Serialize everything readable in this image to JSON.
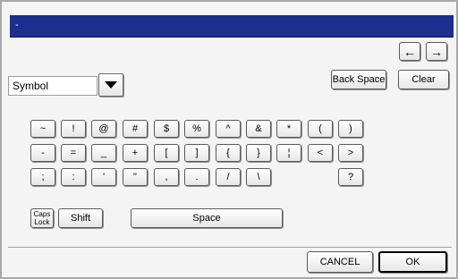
{
  "title": "-",
  "nav": {
    "left_arrow": "←",
    "right_arrow": "→"
  },
  "category": {
    "selected": "Symbol"
  },
  "buttons": {
    "backspace": "Back Space",
    "clear": "Clear",
    "caps_line1": "Caps",
    "caps_line2": "Lock",
    "shift": "Shift",
    "space": "Space",
    "cancel": "CANCEL",
    "ok": "OK"
  },
  "keys": {
    "row1": [
      "~",
      "!",
      "@",
      "#",
      "$",
      "%",
      "^",
      "&",
      "*",
      "(",
      ")"
    ],
    "row2": [
      "-",
      "=",
      "_",
      "+",
      "[",
      "]",
      "{",
      "}",
      "¦",
      "<",
      ">"
    ],
    "row3": [
      ";",
      ":",
      "'",
      "\"",
      ",",
      ".",
      "/",
      "\\",
      "?"
    ]
  }
}
